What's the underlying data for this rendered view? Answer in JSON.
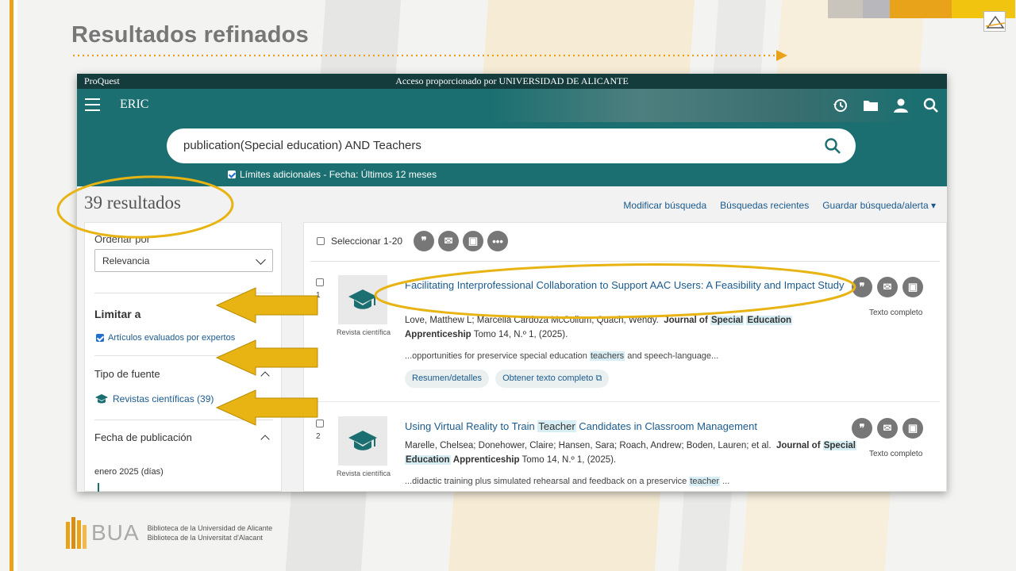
{
  "slide": {
    "title": "Resultados refinados",
    "footer": {
      "logo_text": "BUA",
      "line1": "Biblioteca de la Universidad de Alicante",
      "line2": "Biblioteca de la Universitat d'Alacant"
    }
  },
  "proquest": {
    "brand": "ProQuest",
    "access": "Acceso proporcionado por UNIVERSIDAD DE ALICANTE",
    "db": "ERIC",
    "nav_icons": [
      "history-icon",
      "folder-icon",
      "user-icon",
      "search-icon"
    ]
  },
  "search": {
    "query": "publication(Special education) AND Teachers",
    "limits": "Límites adicionales - Fecha: Últimos 12 meses"
  },
  "results": {
    "count": "39 resultados",
    "links": [
      "Modificar búsqueda",
      "Búsquedas recientes",
      "Guardar búsqueda/alerta ▾"
    ],
    "select_label": "Seleccionar 1-20"
  },
  "sidebar": {
    "sort_label": "Ordenar por",
    "sort_value": "Relevancia",
    "limit_heading": "Limitar a",
    "peer_reviewed": "Artículos evaluados por expertos",
    "source_type_heading": "Tipo de fuente",
    "source_type_item": "Revistas científicas (39)",
    "pub_date_heading": "Fecha de publicación",
    "pub_date_value": "enero 2025 (días)"
  },
  "records": [
    {
      "num": "1",
      "type": "Revista científica",
      "title": "Facilitating Interprofessional Collaboration to Support AAC Users: A Feasibility and Impact Study",
      "authors": "Love, Matthew L; Marcella Cardoza McCollum; Quach, Wendy.",
      "journal_pre": "Journal of",
      "journal_hl1": "Special",
      "journal_hl2": "Education",
      "journal_post": "Apprenticeship",
      "vol": "Tomo 14, N.º 1,  (2025).",
      "snippet_pre": "...opportunities for preservice special education",
      "snippet_hl": "teachers",
      "snippet_post": "and speech-language...",
      "btn_summary": "Resumen/detalles",
      "btn_fulltext": "Obtener texto completo",
      "fulltext_label": "Texto completo"
    },
    {
      "num": "2",
      "type": "Revista científica",
      "title_pre": "Using Virtual Reality to Train",
      "title_hl": "Teacher",
      "title_post": "Candidates in Classroom Management",
      "authors": "Marelle, Chelsea; Donehower, Claire; Hansen, Sara; Roach, Andrew; Boden, Lauren; et al.",
      "journal_pre": "Journal of",
      "journal_hl1": "Special",
      "journal_hl2": "Education",
      "journal_post": "Apprenticeship",
      "vol": "Tomo 14, N.º 1,  (2025).",
      "snippet_pre": "...didactic training plus simulated rehearsal and feedback on a preservice",
      "snippet_hl": "teacher",
      "snippet_post": "...",
      "fulltext_label": "Texto completo"
    }
  ],
  "colors": {
    "teal": "#1b6f70",
    "dark_teal": "#153c3c",
    "annotation_yellow": "#e8b413",
    "link_blue": "#1a5a8e",
    "accent_orange": "#e8a31b"
  }
}
